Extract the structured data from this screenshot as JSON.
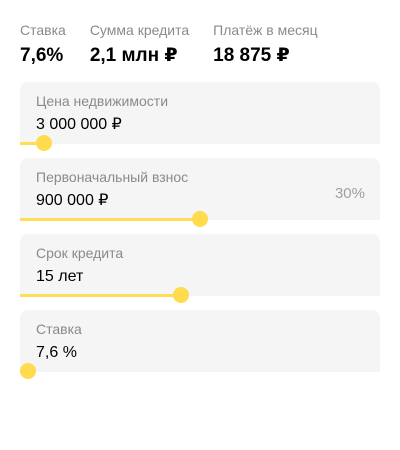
{
  "summary": {
    "rate_label": "Ставка",
    "rate_value": "7,6%",
    "loan_label": "Сумма кредита",
    "loan_value": "2,1 млн ₽",
    "payment_label": "Платёж в месяц",
    "payment_value": "18 875 ₽"
  },
  "fields": {
    "price": {
      "label": "Цена недвижимости",
      "value": "3 000 000 ₽",
      "slider_fraction": 0.067
    },
    "down": {
      "label": "Первоначальный взнос",
      "value": "900 000 ₽",
      "aside": "30%",
      "slider_fraction": 0.5
    },
    "term": {
      "label": "Срок кредита",
      "value": "15 лет",
      "slider_fraction": 0.447
    },
    "rate": {
      "label": "Ставка",
      "value": "7,6 %",
      "slider_fraction": 0.022
    }
  },
  "colors": {
    "accent": "#ffdb4d",
    "field_bg": "#f5f5f5"
  }
}
